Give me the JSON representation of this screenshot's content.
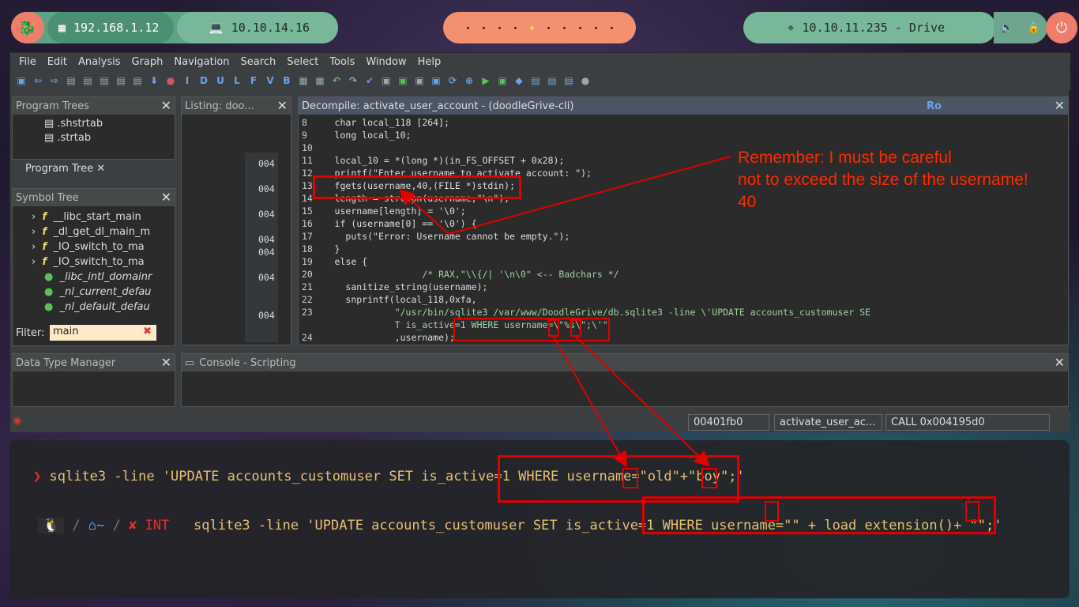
{
  "topbar": {
    "ip_local": "192.168.1.12",
    "ip_vpn": "10.10.14.16",
    "target": "10.10.11.235 - Drive"
  },
  "menu": [
    "File",
    "Edit",
    "Analysis",
    "Graph",
    "Navigation",
    "Search",
    "Select",
    "Tools",
    "Window",
    "Help"
  ],
  "toolbar_letters": [
    "I",
    "D",
    "U",
    "L",
    "F",
    "V",
    "B"
  ],
  "program_trees": {
    "title": "Program Trees",
    "items": [
      ".shstrtab",
      ".strtab"
    ],
    "tab": "Program Tree"
  },
  "symbol_tree": {
    "title": "Symbol Tree",
    "items": [
      "__libc_start_main",
      "_dl_get_dl_main_m",
      "_IO_switch_to_ma",
      "_IO_switch_to_ma",
      "_libc_intl_domainr",
      "_nl_current_defau",
      "_nl_default_defau"
    ],
    "filter_label": "Filter:",
    "filter_value": "main"
  },
  "listing": {
    "title": "Listing:  doo...",
    "addrs": [
      "004",
      "004",
      "004",
      "004",
      "004",
      "004",
      "004"
    ]
  },
  "decompile": {
    "title": "Decompile: activate_user_account -  (doodleGrive-cli)",
    "ro": "Ro",
    "lines": [
      {
        "n": "8",
        "t": "  char local_118 [264];"
      },
      {
        "n": "9",
        "t": "  long local_10;"
      },
      {
        "n": "10",
        "t": ""
      },
      {
        "n": "11",
        "t": "  local_10 = *(long *)(in_FS_OFFSET + 0x28);"
      },
      {
        "n": "12",
        "t": "  printf(\"Enter username to activate account: \");"
      },
      {
        "n": "13",
        "t": "  fgets(username,40,(FILE *)stdin);"
      },
      {
        "n": "14",
        "t": "  length = strcspn(username,\"\\n\");"
      },
      {
        "n": "15",
        "t": "  username[length] = '\\0';"
      },
      {
        "n": "16",
        "t": "  if (username[0] == '\\0') {"
      },
      {
        "n": "17",
        "t": "    puts(\"Error: Username cannot be empty.\");"
      },
      {
        "n": "18",
        "t": "  }"
      },
      {
        "n": "19",
        "t": "  else {"
      },
      {
        "n": "20",
        "t": "                  /* RAX,\"\\\\{/| '\\n\\0\" <-- Badchars */"
      },
      {
        "n": "21",
        "t": "    sanitize_string(username);"
      },
      {
        "n": "22",
        "t": "    snprintf(local_118,0xfa,"
      },
      {
        "n": "23",
        "t": "             \"/usr/bin/sqlite3 /var/www/DoodleGrive/db.sqlite3 -line \\'UPDATE accounts_customuser SE"
      },
      {
        "n": "",
        "t": "             T is_active=1 WHERE username=\\\"%s\\\";\\'\""
      },
      {
        "n": "24",
        "t": "             ,username);"
      }
    ]
  },
  "data_type_manager": {
    "title": "Data Type Manager"
  },
  "console": {
    "title": "Console - Scripting"
  },
  "status": {
    "addr": "00401fb0",
    "func": "activate_user_ac...",
    "instr": "CALL 0x004195d0"
  },
  "annotation": {
    "line1": "Remember: I must be careful",
    "line2": "not to exceed the size of the username!",
    "line3": "40"
  },
  "terminal": {
    "prompt1": "❯",
    "cmd1": "sqlite3 -line 'UPDATE accounts_customuser SET is_active=1 WHERE username=\"old\"+\"boy\";'",
    "prompt2_home": "~",
    "prompt2_err": "✘ INT",
    "cmd2": "sqlite3 -line 'UPDATE accounts_customuser SET is_active=1 WHERE username=\"\" + load_extension()+ \"\";'"
  },
  "colors": {
    "accent_green": "#5fa383",
    "accent_orange": "#f2906f",
    "annotation_red": "#e00000",
    "prompt_red": "#e03030"
  }
}
